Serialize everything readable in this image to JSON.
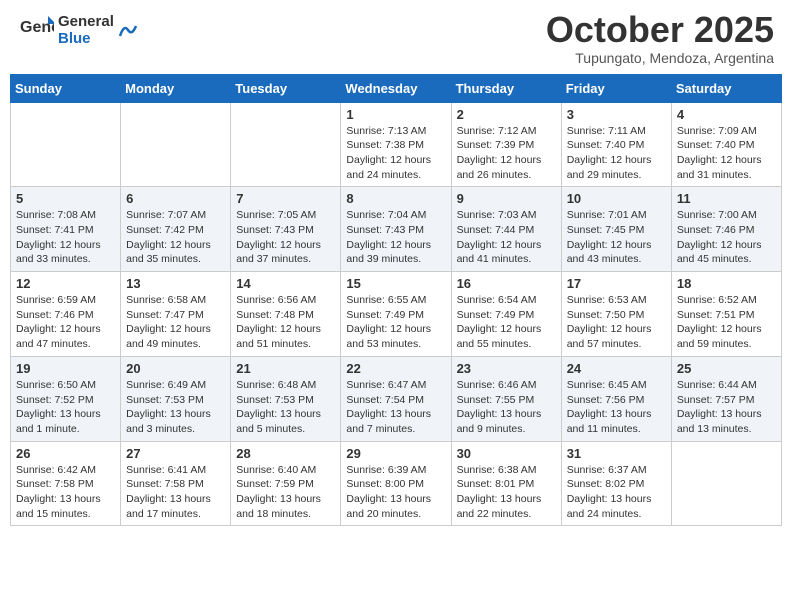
{
  "header": {
    "logo_general": "General",
    "logo_blue": "Blue",
    "month": "October 2025",
    "location": "Tupungato, Mendoza, Argentina"
  },
  "days_of_week": [
    "Sunday",
    "Monday",
    "Tuesday",
    "Wednesday",
    "Thursday",
    "Friday",
    "Saturday"
  ],
  "weeks": [
    [
      {
        "day": "",
        "info": ""
      },
      {
        "day": "",
        "info": ""
      },
      {
        "day": "",
        "info": ""
      },
      {
        "day": "1",
        "info": "Sunrise: 7:13 AM\nSunset: 7:38 PM\nDaylight: 12 hours and 24 minutes."
      },
      {
        "day": "2",
        "info": "Sunrise: 7:12 AM\nSunset: 7:39 PM\nDaylight: 12 hours and 26 minutes."
      },
      {
        "day": "3",
        "info": "Sunrise: 7:11 AM\nSunset: 7:40 PM\nDaylight: 12 hours and 29 minutes."
      },
      {
        "day": "4",
        "info": "Sunrise: 7:09 AM\nSunset: 7:40 PM\nDaylight: 12 hours and 31 minutes."
      }
    ],
    [
      {
        "day": "5",
        "info": "Sunrise: 7:08 AM\nSunset: 7:41 PM\nDaylight: 12 hours and 33 minutes."
      },
      {
        "day": "6",
        "info": "Sunrise: 7:07 AM\nSunset: 7:42 PM\nDaylight: 12 hours and 35 minutes."
      },
      {
        "day": "7",
        "info": "Sunrise: 7:05 AM\nSunset: 7:43 PM\nDaylight: 12 hours and 37 minutes."
      },
      {
        "day": "8",
        "info": "Sunrise: 7:04 AM\nSunset: 7:43 PM\nDaylight: 12 hours and 39 minutes."
      },
      {
        "day": "9",
        "info": "Sunrise: 7:03 AM\nSunset: 7:44 PM\nDaylight: 12 hours and 41 minutes."
      },
      {
        "day": "10",
        "info": "Sunrise: 7:01 AM\nSunset: 7:45 PM\nDaylight: 12 hours and 43 minutes."
      },
      {
        "day": "11",
        "info": "Sunrise: 7:00 AM\nSunset: 7:46 PM\nDaylight: 12 hours and 45 minutes."
      }
    ],
    [
      {
        "day": "12",
        "info": "Sunrise: 6:59 AM\nSunset: 7:46 PM\nDaylight: 12 hours and 47 minutes."
      },
      {
        "day": "13",
        "info": "Sunrise: 6:58 AM\nSunset: 7:47 PM\nDaylight: 12 hours and 49 minutes."
      },
      {
        "day": "14",
        "info": "Sunrise: 6:56 AM\nSunset: 7:48 PM\nDaylight: 12 hours and 51 minutes."
      },
      {
        "day": "15",
        "info": "Sunrise: 6:55 AM\nSunset: 7:49 PM\nDaylight: 12 hours and 53 minutes."
      },
      {
        "day": "16",
        "info": "Sunrise: 6:54 AM\nSunset: 7:49 PM\nDaylight: 12 hours and 55 minutes."
      },
      {
        "day": "17",
        "info": "Sunrise: 6:53 AM\nSunset: 7:50 PM\nDaylight: 12 hours and 57 minutes."
      },
      {
        "day": "18",
        "info": "Sunrise: 6:52 AM\nSunset: 7:51 PM\nDaylight: 12 hours and 59 minutes."
      }
    ],
    [
      {
        "day": "19",
        "info": "Sunrise: 6:50 AM\nSunset: 7:52 PM\nDaylight: 13 hours and 1 minute."
      },
      {
        "day": "20",
        "info": "Sunrise: 6:49 AM\nSunset: 7:53 PM\nDaylight: 13 hours and 3 minutes."
      },
      {
        "day": "21",
        "info": "Sunrise: 6:48 AM\nSunset: 7:53 PM\nDaylight: 13 hours and 5 minutes."
      },
      {
        "day": "22",
        "info": "Sunrise: 6:47 AM\nSunset: 7:54 PM\nDaylight: 13 hours and 7 minutes."
      },
      {
        "day": "23",
        "info": "Sunrise: 6:46 AM\nSunset: 7:55 PM\nDaylight: 13 hours and 9 minutes."
      },
      {
        "day": "24",
        "info": "Sunrise: 6:45 AM\nSunset: 7:56 PM\nDaylight: 13 hours and 11 minutes."
      },
      {
        "day": "25",
        "info": "Sunrise: 6:44 AM\nSunset: 7:57 PM\nDaylight: 13 hours and 13 minutes."
      }
    ],
    [
      {
        "day": "26",
        "info": "Sunrise: 6:42 AM\nSunset: 7:58 PM\nDaylight: 13 hours and 15 minutes."
      },
      {
        "day": "27",
        "info": "Sunrise: 6:41 AM\nSunset: 7:58 PM\nDaylight: 13 hours and 17 minutes."
      },
      {
        "day": "28",
        "info": "Sunrise: 6:40 AM\nSunset: 7:59 PM\nDaylight: 13 hours and 18 minutes."
      },
      {
        "day": "29",
        "info": "Sunrise: 6:39 AM\nSunset: 8:00 PM\nDaylight: 13 hours and 20 minutes."
      },
      {
        "day": "30",
        "info": "Sunrise: 6:38 AM\nSunset: 8:01 PM\nDaylight: 13 hours and 22 minutes."
      },
      {
        "day": "31",
        "info": "Sunrise: 6:37 AM\nSunset: 8:02 PM\nDaylight: 13 hours and 24 minutes."
      },
      {
        "day": "",
        "info": ""
      }
    ]
  ]
}
